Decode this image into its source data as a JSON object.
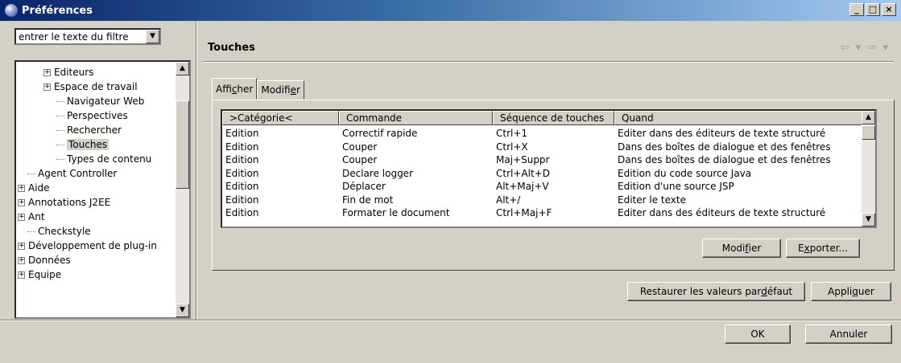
{
  "window": {
    "title": "Préférences",
    "minimize": "_",
    "maximize": "□",
    "close": "×"
  },
  "filter": {
    "value": "entrer le texte du filtre"
  },
  "tree": {
    "items": [
      {
        "label": "Editeurs",
        "expander": "+"
      },
      {
        "label": "Espace de travail",
        "expander": "+"
      },
      {
        "label": "Navigateur Web"
      },
      {
        "label": "Perspectives"
      },
      {
        "label": "Rechercher"
      },
      {
        "label": "Touches",
        "selected": true
      },
      {
        "label": "Types de contenu"
      },
      {
        "label": "Agent Controller"
      },
      {
        "label": "Aide",
        "expander": "+"
      },
      {
        "label": "Annotations J2EE",
        "expander": "+"
      },
      {
        "label": "Ant",
        "expander": "+"
      },
      {
        "label": "Checkstyle"
      },
      {
        "label": "Développement de plug-in",
        "expander": "+"
      },
      {
        "label": "Données",
        "expander": "+"
      },
      {
        "label": "Equipe",
        "expander": "+"
      }
    ]
  },
  "page": {
    "title": "Touches",
    "nav": "⇦ ▾ ⇨ ▾"
  },
  "tabs": [
    {
      "label_pre": "Affi",
      "label_u": "c",
      "label_post": "her"
    },
    {
      "label_pre": "Modifi",
      "label_u": "e",
      "label_post": "r"
    }
  ],
  "table": {
    "columns": [
      ">Catégorie<",
      "Commande",
      "Séquence de touches",
      "Quand"
    ],
    "rows": [
      [
        "Edition",
        "Correctif rapide",
        "Ctrl+1",
        "Editer dans des éditeurs de texte structuré"
      ],
      [
        "Edition",
        "Couper",
        "Ctrl+X",
        "Dans des boîtes de dialogue et des fenêtres"
      ],
      [
        "Edition",
        "Couper",
        "Maj+Suppr",
        "Dans des boîtes de dialogue et des fenêtres"
      ],
      [
        "Edition",
        "Declare logger",
        "Ctrl+Alt+D",
        "Edition du code source Java"
      ],
      [
        "Edition",
        "Déplacer",
        "Alt+Maj+V",
        "Edition d'une source JSP"
      ],
      [
        "Edition",
        "Fin de mot",
        "Alt+/",
        "Editer le texte"
      ],
      [
        "Edition",
        "Formater le document",
        "Ctrl+Maj+F",
        "Editer dans des éditeurs de texte structuré"
      ]
    ]
  },
  "buttons": {
    "modifier": {
      "pre": "Modi",
      "u": "f",
      "post": "ier"
    },
    "exporter": {
      "pre": "E",
      "u": "x",
      "post": "porter..."
    },
    "restaurer": {
      "pre": "Restaurer les valeurs par ",
      "u": "d",
      "post": "éfaut"
    },
    "appliquer": {
      "pre": "Appli",
      "u": "q",
      "post": "uer"
    },
    "ok": "OK",
    "annuler": "Annuler"
  }
}
